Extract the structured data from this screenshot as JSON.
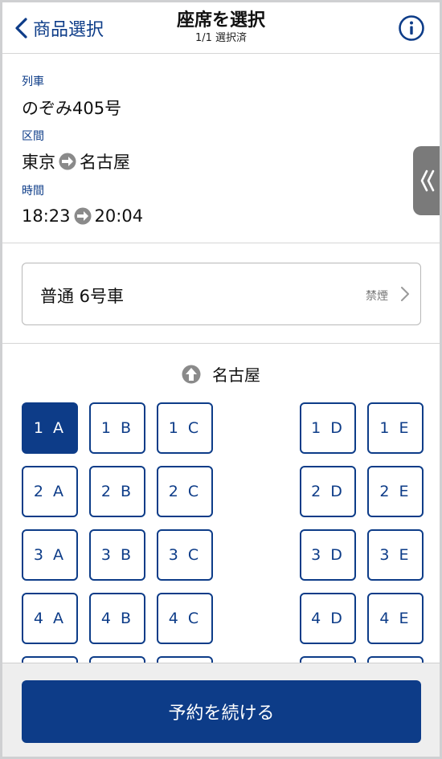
{
  "header": {
    "back_label": "商品選択",
    "title": "座席を選択",
    "subtitle": "1/1 選択済"
  },
  "trip": {
    "train_label": "列車",
    "train_value": "のぞみ405号",
    "section_label": "区間",
    "from": "東京",
    "to": "名古屋",
    "time_label": "時間",
    "depart_time": "18:23",
    "arrive_time": "20:04"
  },
  "car": {
    "label": "普通 6号車",
    "note": "禁煙"
  },
  "seatmap": {
    "direction_label": "名古屋",
    "rows": [
      {
        "left": [
          "1 A",
          "1 B",
          "1 C"
        ],
        "right": [
          "1 D",
          "1 E"
        ]
      },
      {
        "left": [
          "2 A",
          "2 B",
          "2 C"
        ],
        "right": [
          "2 D",
          "2 E"
        ]
      },
      {
        "left": [
          "3 A",
          "3 B",
          "3 C"
        ],
        "right": [
          "3 D",
          "3 E"
        ]
      },
      {
        "left": [
          "4 A",
          "4 B",
          "4 C"
        ],
        "right": [
          "4 D",
          "4 E"
        ]
      }
    ],
    "selected_seat": "1 A"
  },
  "footer": {
    "continue_label": "予約を続ける"
  },
  "colors": {
    "accent": "#0d3c88",
    "background": "#ffffff",
    "footer_bg": "#eeeeee"
  }
}
